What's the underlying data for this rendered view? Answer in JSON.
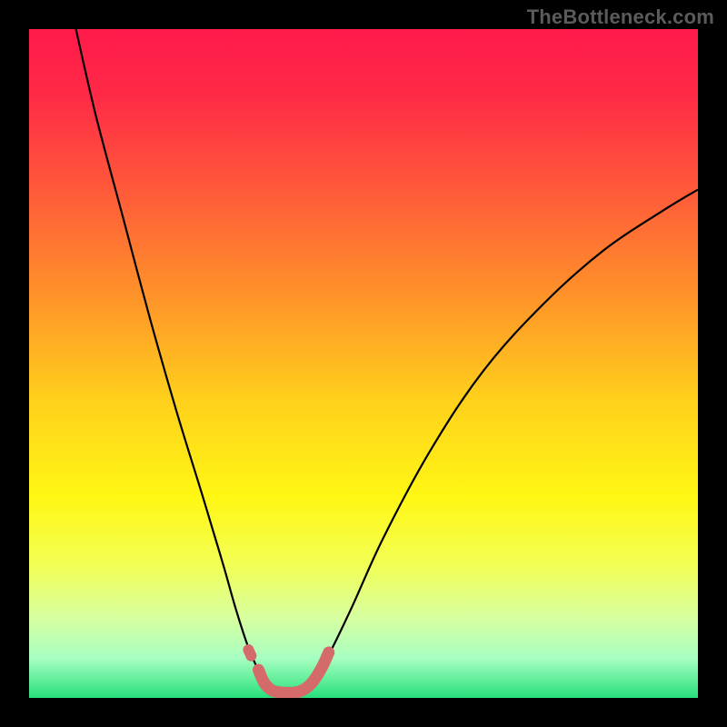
{
  "watermark": "TheBottleneck.com",
  "chart_data": {
    "type": "line",
    "title": "",
    "xlabel": "",
    "ylabel": "",
    "xlim": [
      0,
      100
    ],
    "ylim": [
      0,
      100
    ],
    "grid": false,
    "legend": false,
    "background": {
      "orientation": "vertical",
      "stops": [
        {
          "offset": 0.0,
          "color": "#ff1a4b"
        },
        {
          "offset": 0.1,
          "color": "#ff2a46"
        },
        {
          "offset": 0.25,
          "color": "#ff5d39"
        },
        {
          "offset": 0.4,
          "color": "#ff9329"
        },
        {
          "offset": 0.55,
          "color": "#ffcf1c"
        },
        {
          "offset": 0.7,
          "color": "#fff714"
        },
        {
          "offset": 0.8,
          "color": "#f2ff54"
        },
        {
          "offset": 0.88,
          "color": "#d7ffa0"
        },
        {
          "offset": 0.94,
          "color": "#a8ffc1"
        },
        {
          "offset": 1.0,
          "color": "#27e07c"
        }
      ]
    },
    "series": [
      {
        "name": "bottleneck-curve",
        "stroke": "#000000",
        "stroke_width": 2.2,
        "points": [
          {
            "x": 7.0,
            "y": 100.0
          },
          {
            "x": 10.0,
            "y": 87.0
          },
          {
            "x": 14.0,
            "y": 72.0
          },
          {
            "x": 18.0,
            "y": 57.0
          },
          {
            "x": 22.0,
            "y": 43.0
          },
          {
            "x": 26.0,
            "y": 30.0
          },
          {
            "x": 29.0,
            "y": 20.0
          },
          {
            "x": 31.0,
            "y": 13.0
          },
          {
            "x": 33.0,
            "y": 7.0
          },
          {
            "x": 35.0,
            "y": 3.0
          },
          {
            "x": 37.0,
            "y": 1.2
          },
          {
            "x": 39.0,
            "y": 0.7
          },
          {
            "x": 41.0,
            "y": 1.3
          },
          {
            "x": 44.0,
            "y": 5.0
          },
          {
            "x": 48.0,
            "y": 13.0
          },
          {
            "x": 53.0,
            "y": 24.0
          },
          {
            "x": 60.0,
            "y": 37.0
          },
          {
            "x": 68.0,
            "y": 49.0
          },
          {
            "x": 77.0,
            "y": 59.0
          },
          {
            "x": 86.0,
            "y": 67.0
          },
          {
            "x": 95.0,
            "y": 73.0
          },
          {
            "x": 100.0,
            "y": 76.0
          }
        ]
      },
      {
        "name": "highlight-left-dot",
        "stroke": "#d46a6a",
        "stroke_width": 12,
        "linecap": "round",
        "points": [
          {
            "x": 32.8,
            "y": 7.2
          },
          {
            "x": 33.2,
            "y": 6.3
          }
        ]
      },
      {
        "name": "highlight-u",
        "stroke": "#d46a6a",
        "stroke_width": 13,
        "linecap": "round",
        "points": [
          {
            "x": 34.3,
            "y": 4.2
          },
          {
            "x": 35.2,
            "y": 2.2
          },
          {
            "x": 36.4,
            "y": 1.1
          },
          {
            "x": 38.0,
            "y": 0.8
          },
          {
            "x": 39.6,
            "y": 0.8
          },
          {
            "x": 41.0,
            "y": 1.2
          },
          {
            "x": 42.4,
            "y": 2.4
          },
          {
            "x": 43.8,
            "y": 4.6
          },
          {
            "x": 44.8,
            "y": 6.8
          }
        ]
      }
    ]
  }
}
